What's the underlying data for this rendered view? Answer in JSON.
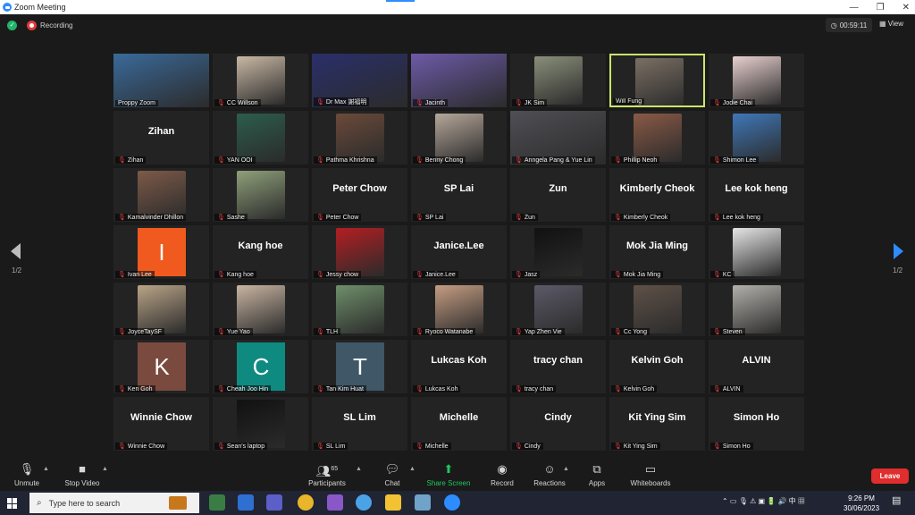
{
  "window": {
    "title": "Zoom Meeting",
    "controls": [
      "—",
      "❐",
      "✕"
    ]
  },
  "topbar": {
    "recording_label": "Recording",
    "timer": "00:59:11",
    "view_label": "View"
  },
  "pagination": {
    "left": "1/2",
    "right": "1/2"
  },
  "participants": [
    {
      "name": "Proppy Zoom",
      "big": "",
      "kind": "photo",
      "color": "#3a6a9a",
      "muted": false,
      "active": false
    },
    {
      "name": "CC Willson",
      "big": "",
      "kind": "photo",
      "color": "#c9b8a4",
      "muted": true,
      "active": false
    },
    {
      "name": "Dr Max 謝福明",
      "big": "",
      "kind": "photo",
      "color": "#2a2f6a",
      "muted": true,
      "active": false
    },
    {
      "name": "Jacinth",
      "big": "",
      "kind": "photo",
      "color": "#6d5aa8",
      "muted": true,
      "active": false
    },
    {
      "name": "JK Sim",
      "big": "",
      "kind": "photo",
      "color": "#8a8f7a",
      "muted": true,
      "active": false
    },
    {
      "name": "Will Fung",
      "big": "",
      "kind": "photo",
      "color": "#7a6f64",
      "muted": false,
      "active": true
    },
    {
      "name": "Jodie Chai",
      "big": "",
      "kind": "photo",
      "color": "#e8d0cf",
      "muted": true,
      "active": false
    },
    {
      "name": "Zihan",
      "big": "Zihan",
      "kind": "text",
      "color": "",
      "muted": true,
      "active": false
    },
    {
      "name": "YAN OOI",
      "big": "",
      "kind": "photo",
      "color": "#2c5d4d",
      "muted": true,
      "active": false
    },
    {
      "name": "Pathma Khrishna",
      "big": "",
      "kind": "photo",
      "color": "#6b4a3a",
      "muted": true,
      "active": false
    },
    {
      "name": "Benny Chong",
      "big": "",
      "kind": "photo",
      "color": "#b6a79a",
      "muted": true,
      "active": false
    },
    {
      "name": "Anngela Pang & Yue Lin",
      "big": "",
      "kind": "photo",
      "color": "#4f4f55",
      "muted": true,
      "active": false
    },
    {
      "name": "Phillip Neoh",
      "big": "",
      "kind": "photo",
      "color": "#8a5a46",
      "muted": true,
      "active": false
    },
    {
      "name": "Shimon Lee",
      "big": "",
      "kind": "photo",
      "color": "#3f78b8",
      "muted": true,
      "active": false
    },
    {
      "name": "Kamalvinder Dhillon",
      "big": "",
      "kind": "photo",
      "color": "#7d5a48",
      "muted": true,
      "active": false
    },
    {
      "name": "Sashe",
      "big": "",
      "kind": "photo",
      "color": "#8fa07a",
      "muted": true,
      "active": false
    },
    {
      "name": "Peter Chow",
      "big": "Peter Chow",
      "kind": "text",
      "color": "",
      "muted": true,
      "active": false
    },
    {
      "name": "SP Lai",
      "big": "SP Lai",
      "kind": "text",
      "color": "",
      "muted": true,
      "active": false
    },
    {
      "name": "Zun",
      "big": "Zun",
      "kind": "text",
      "color": "",
      "muted": true,
      "active": false
    },
    {
      "name": "Kimberly Cheok",
      "big": "Kimberly Cheok",
      "kind": "text",
      "color": "",
      "muted": true,
      "active": false
    },
    {
      "name": "Lee kok heng",
      "big": "Lee kok heng",
      "kind": "text",
      "color": "",
      "muted": true,
      "active": false
    },
    {
      "name": "Ivan Lee",
      "big": "I",
      "kind": "initial",
      "color": "#f05a1e",
      "muted": true,
      "active": false
    },
    {
      "name": "Kang hoe",
      "big": "Kang hoe",
      "kind": "text",
      "color": "",
      "muted": true,
      "active": false
    },
    {
      "name": "Jessy chow",
      "big": "",
      "kind": "photo",
      "color": "#b41e22",
      "muted": true,
      "active": false
    },
    {
      "name": "Janice.Lee",
      "big": "Janice.Lee",
      "kind": "text",
      "color": "",
      "muted": true,
      "active": false
    },
    {
      "name": "Jasz",
      "big": "",
      "kind": "photo",
      "color": "#111111",
      "muted": true,
      "active": false
    },
    {
      "name": "Mok Jia Ming",
      "big": "Mok Jia Ming",
      "kind": "text",
      "color": "",
      "muted": true,
      "active": false
    },
    {
      "name": "KC",
      "big": "",
      "kind": "photo",
      "color": "#e6e6e6",
      "muted": true,
      "active": false
    },
    {
      "name": "JoyceTaySF",
      "big": "",
      "kind": "photo",
      "color": "#b9a487",
      "muted": true,
      "active": false
    },
    {
      "name": "Yue Yao",
      "big": "",
      "kind": "photo",
      "color": "#c9b4a2",
      "muted": true,
      "active": false
    },
    {
      "name": "TLH",
      "big": "",
      "kind": "photo",
      "color": "#6e8f6a",
      "muted": true,
      "active": false
    },
    {
      "name": "Ryoco Watanabe",
      "big": "",
      "kind": "photo",
      "color": "#c59d82",
      "muted": true,
      "active": false
    },
    {
      "name": "Yap Zhen Vie",
      "big": "",
      "kind": "photo",
      "color": "#5b5a68",
      "muted": true,
      "active": false
    },
    {
      "name": "Cc Yong",
      "big": "",
      "kind": "photo",
      "color": "#5f5148",
      "muted": true,
      "active": false
    },
    {
      "name": "Steven",
      "big": "",
      "kind": "photo",
      "color": "#b3b0aa",
      "muted": true,
      "active": false
    },
    {
      "name": "Ken Goh",
      "big": "K",
      "kind": "initial",
      "color": "#7a4a3e",
      "muted": true,
      "active": false
    },
    {
      "name": "Cheah Joo Hin",
      "big": "C",
      "kind": "initial",
      "color": "#0f8a80",
      "muted": true,
      "active": false
    },
    {
      "name": "Tan Kim Huat",
      "big": "T",
      "kind": "initial",
      "color": "#3f5766",
      "muted": true,
      "active": false
    },
    {
      "name": "Lukcas Koh",
      "big": "Lukcas Koh",
      "kind": "text",
      "color": "",
      "muted": true,
      "active": false
    },
    {
      "name": "tracy chan",
      "big": "tracy chan",
      "kind": "text",
      "color": "",
      "muted": true,
      "active": false
    },
    {
      "name": "Kelvin Goh",
      "big": "Kelvin Goh",
      "kind": "text",
      "color": "",
      "muted": true,
      "active": false
    },
    {
      "name": "ALVIN",
      "big": "ALVIN",
      "kind": "text",
      "color": "",
      "muted": true,
      "active": false
    },
    {
      "name": "Winnie Chow",
      "big": "Winnie Chow",
      "kind": "text",
      "color": "",
      "muted": true,
      "active": false
    },
    {
      "name": "Sean's laptop",
      "big": "",
      "kind": "photo",
      "color": "#111111",
      "muted": true,
      "active": false
    },
    {
      "name": "SL Lim",
      "big": "SL Lim",
      "kind": "text",
      "color": "",
      "muted": true,
      "active": false
    },
    {
      "name": "Michelle",
      "big": "Michelle",
      "kind": "text",
      "color": "",
      "muted": true,
      "active": false
    },
    {
      "name": "Cindy",
      "big": "Cindy",
      "kind": "text",
      "color": "",
      "muted": true,
      "active": false
    },
    {
      "name": "Kit Ying Sim",
      "big": "Kit Ying Sim",
      "kind": "text",
      "color": "",
      "muted": true,
      "active": false
    },
    {
      "name": "Simon Ho",
      "big": "Simon Ho",
      "kind": "text",
      "color": "",
      "muted": true,
      "active": false
    }
  ],
  "toolbar": {
    "unmute": "Unmute",
    "stop_video": "Stop Video",
    "participants": "Participants",
    "participants_count": "65",
    "chat": "Chat",
    "share_screen": "Share Screen",
    "record": "Record",
    "reactions": "Reactions",
    "apps": "Apps",
    "whiteboards": "Whiteboards",
    "leave": "Leave",
    "share_color": "#23c55e"
  },
  "taskbar": {
    "search_placeholder": "Type here to search",
    "time": "9:26 PM",
    "date": "30/06/2023"
  }
}
